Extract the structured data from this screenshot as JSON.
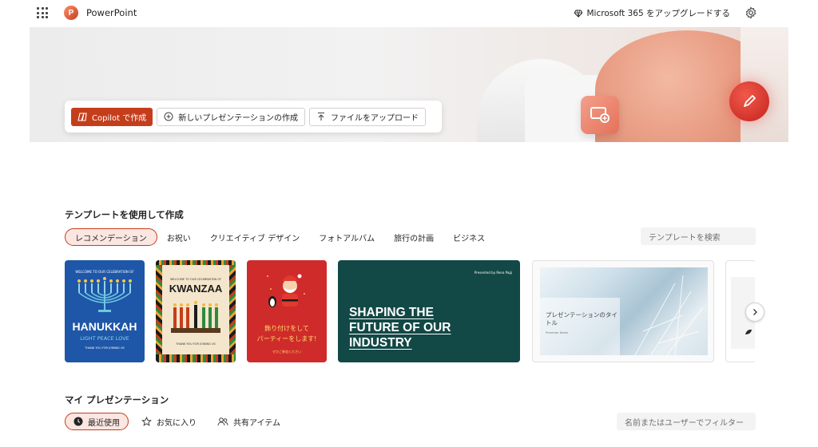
{
  "app": {
    "name": "PowerPoint",
    "upgrade_label": "Microsoft 365 をアップグレードする"
  },
  "hero": {
    "copilot_label": "Copilot で作成",
    "new_label": "新しいプレゼンテーションの作成",
    "upload_label": "ファイルをアップロード"
  },
  "templates": {
    "heading": "テンプレートを使用して作成",
    "tabs": [
      "レコメンデーション",
      "お祝い",
      "クリエイティブ デザイン",
      "フォトアルバム",
      "旅行の計画",
      "ビジネス"
    ],
    "search_placeholder": "テンプレートを検索",
    "cards": {
      "hanukkah": {
        "top": "WELCOME TO OUR CELEBRATION OF",
        "title": "HANUKKAH",
        "sub": "LIGHT PEACE LOVE",
        "foot": "THANK YOU FOR JOINING US"
      },
      "kwanzaa": {
        "top": "WELCOME TO OUR CELEBRATION OF",
        "title": "KWANZAA",
        "foot": "THANK YOU FOR JOINING US"
      },
      "xmas": {
        "line1": "飾り付けをして",
        "line2": "パーティーをします!",
        "foot": "ぜひご参加ください"
      },
      "shaping": {
        "presented": "Presented by Rena Pagi",
        "title": "SHAPING THE FUTURE OF OUR INDUSTRY"
      },
      "photo": {
        "title": "プレゼンテーションのタイトル",
        "sub": "Presenter Name"
      }
    }
  },
  "presentations": {
    "heading": "マイ プレゼンテーション",
    "tabs": [
      "最近使用",
      "お気に入り",
      "共有アイテム"
    ],
    "filter_placeholder": "名前またはユーザーでフィルター"
  },
  "colors": {
    "accent": "#c43e1c",
    "accent_light": "#fbe6e1",
    "card_dark": "#124845"
  }
}
